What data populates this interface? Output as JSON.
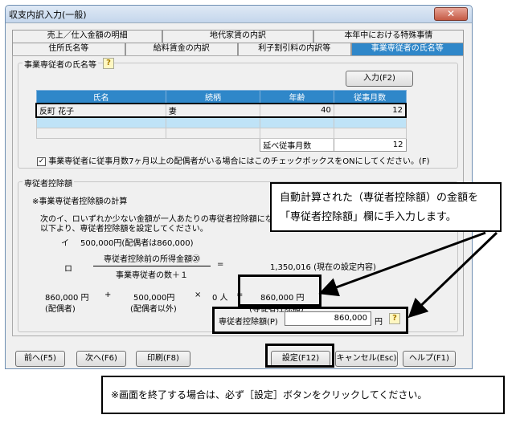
{
  "window": {
    "title": "収支内訳入力(一般)",
    "close": "✕"
  },
  "tabs_row1": [
    "売上／仕入金額の明細",
    "地代家賃の内訳",
    "本年中における特殊事情"
  ],
  "tabs_row2": [
    "住所氏名等",
    "給料賃金の内訳",
    "利子割引料の内訳等",
    "事業専従者の氏名等"
  ],
  "group1": {
    "label": "事業専従者の氏名等",
    "input_button": "入力(F2)",
    "columns": [
      "氏名",
      "続柄",
      "年齢",
      "従事月数"
    ],
    "rows": [
      [
        "反町 花子",
        "妻",
        "40",
        "12"
      ],
      [
        "",
        "",
        "",
        ""
      ],
      [
        "",
        "",
        "",
        ""
      ]
    ],
    "total_label": "延べ従事月数",
    "total_value": "12",
    "checkbox_label": "事業専従者に従事月数7ヶ月以上の配偶者がいる場合にはこのチェックボックスをONにしてください。(F)",
    "checkbox_checked": "✓"
  },
  "group2": {
    "label": "専従者控除額",
    "heading": "※事業専従者控除額の計算",
    "desc1": "次のイ、ロいずれか少ない金額が一人あたりの専従者控除額になります。",
    "desc2": "以下より、専従者控除額を設定してください。",
    "i_label": "イ",
    "i_text": "500,000円(配偶者は860,000)",
    "ro_label": "ロ",
    "fraction_num": "専従者控除前の所得金額⑳",
    "fraction_den": "事業専従者の数＋１",
    "equals": "=",
    "result_ro": "1,350,016 (現在の設定内容)",
    "calc_a": "860,000 円",
    "plus": "+",
    "calc_b": "500,000円",
    "times": "×",
    "calc_c": "0 人",
    "equals2": "=",
    "calc_result": "860,000 円",
    "calc_a_label": "(配偶者)",
    "calc_b_label": "(配偶者以外)",
    "calc_result_label": "(専従者控除額)",
    "field_label": "専従者控除額(P)",
    "field_value": "860,000",
    "field_unit": "円"
  },
  "bottom_buttons": [
    "前へ(F5)",
    "次へ(F6)",
    "印刷(F8)",
    "設定(F12)",
    "キャンセル(Esc)",
    "ヘルプ(F1)"
  ],
  "callout": {
    "line1": "自動計算された（専従者控除額）の金額を",
    "line2": "「専従者控除額」欄に手入力します。"
  },
  "note": "※画面を終了する場合は、必ず［設定］ボタンをクリックしてください。",
  "help_icon": "?"
}
